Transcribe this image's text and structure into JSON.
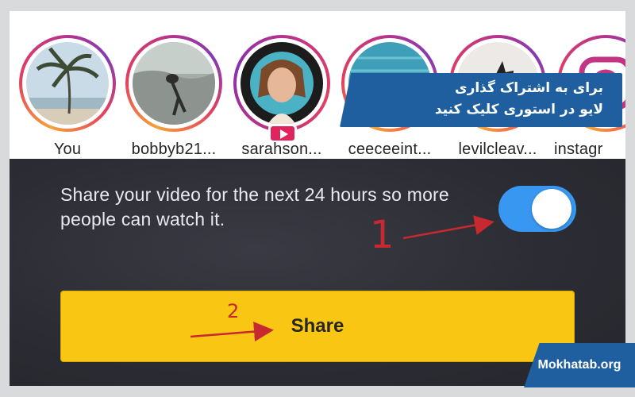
{
  "stories": [
    {
      "label": "You",
      "icon": "palm-tree-photo"
    },
    {
      "label": "bobbyb21...",
      "icon": "dog-photo"
    },
    {
      "label": "sarahson...",
      "icon": "person-photo",
      "live": true
    },
    {
      "label": "ceeceeint...",
      "icon": "blue-texture-photo"
    },
    {
      "label": "levilcleav...",
      "icon": "cat-photo"
    },
    {
      "label": "instagr",
      "icon": "instagram-logo"
    }
  ],
  "share_setting": {
    "text": "Share your video for the next 24 hours so more people can watch it.",
    "toggle_on": true
  },
  "share_button": {
    "label": "Share"
  },
  "annotations": {
    "step1": "1",
    "step2": "2"
  },
  "callout": {
    "line1": "برای به اشتراک گذاری",
    "line2": "لایو در استوری کلیک کنید"
  },
  "watermark": "Mokhatab.org",
  "colors": {
    "toggle": "#3897f0",
    "button": "#f8c613",
    "annotation": "#c8282f",
    "callout": "#1f5fa0"
  }
}
